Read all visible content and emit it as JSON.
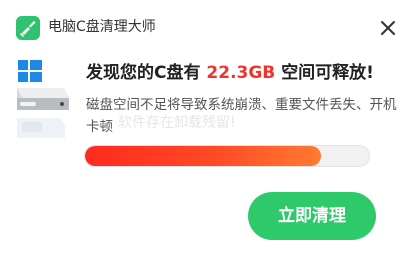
{
  "app": {
    "title": "电脑C盘清理大师",
    "logo_icon": "broom-logo-icon"
  },
  "close_icon": "close-icon",
  "headline": {
    "prefix": "发现您的C盘有",
    "size": "22.3GB",
    "suffix": "空间可释放!"
  },
  "description": "磁盘空间不足将导致系统崩溃、重要文件丢失、开机卡顿",
  "watermark": "软件存在卸载残留!",
  "progress": {
    "value": 0.83
  },
  "cta": {
    "label": "立即清理"
  },
  "colors": {
    "accent_green": "#2dc96a",
    "alert_red": "#f0332b",
    "progress_start": "#ff2a1e",
    "progress_end": "#ff7a30"
  },
  "drive_icon": "hard-drive-windows-icon"
}
